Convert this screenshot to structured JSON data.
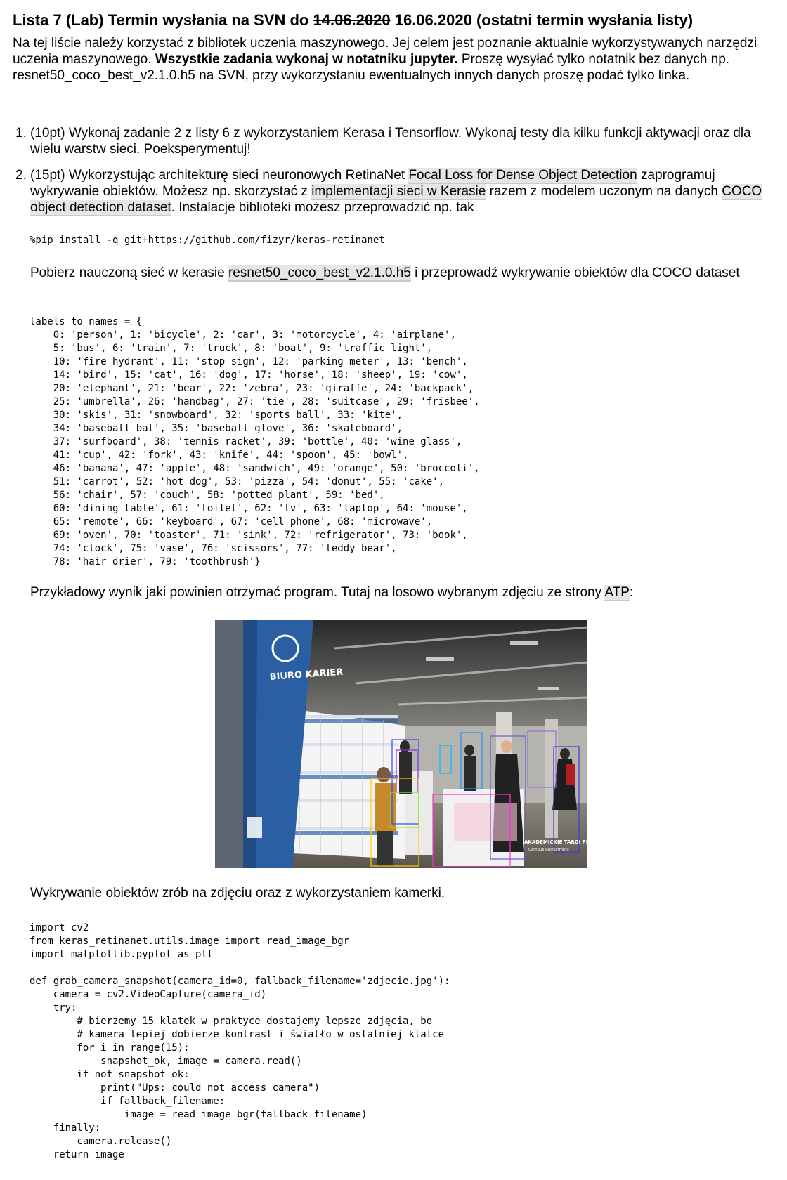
{
  "title": {
    "prefix": "Lista 7 (Lab) Termin wysłania na SVN do",
    "old_date": "14.06.2020",
    "rest": "16.06.2020 (ostatni termin wysłania listy)"
  },
  "intro": {
    "part1": "Na tej liście należy korzystać z bibliotek uczenia maszynowego. Jej celem jest poznanie aktualnie wykorzystywanych narzędzi uczenia maszynowego.",
    "bold": "Wszystkie zadania wykonaj w notatniku jupyter.",
    "part2": "Proszę wysyłać tylko notatnik bez danych np. resnet50_coco_best_v2.1.0.h5 na SVN, przy wykorzystaniu ewentualnych innych danych proszę podać tylko linka."
  },
  "task1": {
    "number": "1.",
    "text": "(10pt) Wykonaj zadanie 2 z listy 6 z wykorzystaniem Kerasa i Tensorflow. Wykonaj testy dla kilku funkcji aktywacji oraz dla wielu warstw sieci. Poeksperymentuj!"
  },
  "task2": {
    "number": "2.",
    "t1": "(15pt) Wykorzystując architekturę sieci neuronowych RetinaNet",
    "link1": "Focal Loss for Dense Object Detection",
    "t2": "zaprogramuj wykrywanie obiektów. Możesz np. skorzystać z",
    "link2": "implementacji sieci w Kerasie",
    "t3": "razem z modelem uczonym na danych",
    "link3": "COCO object detection dataset",
    "t4": ". Instalacje biblioteki możesz przeprowadzić np. tak"
  },
  "code_install": "%pip install -q git+https://github.com/fizyr/keras-retinanet",
  "download": {
    "t1": "Pobierz nauczoną sieć w kerasie",
    "link": "resnet50_coco_best_v2.1.0.h5",
    "t2": "i przeprowadź wykrywanie obiektów dla COCO dataset"
  },
  "code_labels": "labels_to_names = {\n    0: 'person', 1: 'bicycle', 2: 'car', 3: 'motorcycle', 4: 'airplane',\n    5: 'bus', 6: 'train', 7: 'truck', 8: 'boat', 9: 'traffic light',\n    10: 'fire hydrant', 11: 'stop sign', 12: 'parking meter', 13: 'bench',\n    14: 'bird', 15: 'cat', 16: 'dog', 17: 'horse', 18: 'sheep', 19: 'cow',\n    20: 'elephant', 21: 'bear', 22: 'zebra', 23: 'giraffe', 24: 'backpack',\n    25: 'umbrella', 26: 'handbag', 27: 'tie', 28: 'suitcase', 29: 'frisbee',\n    30: 'skis', 31: 'snowboard', 32: 'sports ball', 33: 'kite',\n    34: 'baseball bat', 35: 'baseball glove', 36: 'skateboard',\n    37: 'surfboard', 38: 'tennis racket', 39: 'bottle', 40: 'wine glass',\n    41: 'cup', 42: 'fork', 43: 'knife', 44: 'spoon', 45: 'bowl',\n    46: 'banana', 47: 'apple', 48: 'sandwich', 49: 'orange', 50: 'broccoli',\n    51: 'carrot', 52: 'hot dog', 53: 'pizza', 54: 'donut', 55: 'cake',\n    56: 'chair', 57: 'couch', 58: 'potted plant', 59: 'bed',\n    60: 'dining table', 61: 'toilet', 62: 'tv', 63: 'laptop', 64: 'mouse',\n    65: 'remote', 66: 'keyboard', 67: 'cell phone', 68: 'microwave',\n    69: 'oven', 70: 'toaster', 71: 'sink', 72: 'refrigerator', 73: 'book',\n    74: 'clock', 75: 'vase', 76: 'scissors', 77: 'teddy bear',\n    78: 'hair drier', 79: 'toothbrush'}",
  "example": {
    "t1": "Przykładowy wynik jaki powinien otrzymać program. Tutaj na losowo wybranym zdjęciu ze strony",
    "link": "ATP",
    "t2": ":"
  },
  "photo": {
    "banner_text": "BIURO KARIER",
    "watermark": "AKADEMICKIE TARGI PRACY",
    "watermark_sub": "Campus Recruitment"
  },
  "camera_text": "Wykrywanie obiektów zrób na zdjęciu oraz z wykorzystaniem kamerki.",
  "code_camera": "import cv2\nfrom keras_retinanet.utils.image import read_image_bgr\nimport matplotlib.pyplot as plt\n\ndef grab_camera_snapshot(camera_id=0, fallback_filename='zdjecie.jpg'):\n    camera = cv2.VideoCapture(camera_id)\n    try:\n        # bierzemy 15 klatek w praktyce dostajemy lepsze zdjęcia, bo\n        # kamera lepiej dobierze kontrast i światło w ostatniej klatce\n        for i in range(15):\n            snapshot_ok, image = camera.read()\n        if not snapshot_ok:\n            print(\"Ups: could not access camera\")\n            if fallback_filename:\n                image = read_image_bgr(fallback_filename)\n    finally:\n        camera.release()\n    return image"
}
